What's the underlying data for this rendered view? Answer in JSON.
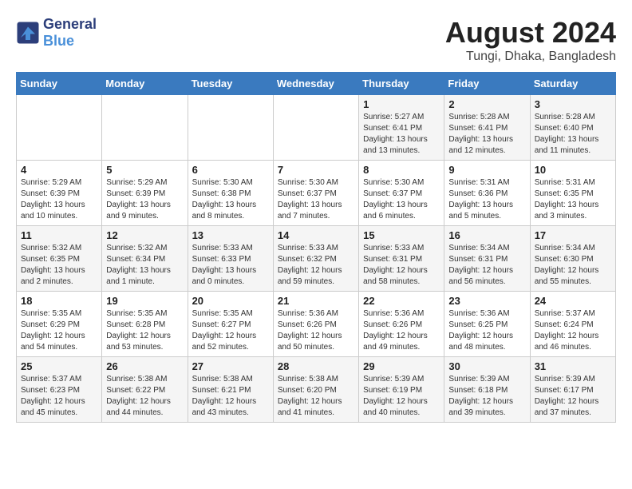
{
  "header": {
    "logo_line1": "General",
    "logo_line2": "Blue",
    "month_year": "August 2024",
    "location": "Tungi, Dhaka, Bangladesh"
  },
  "weekdays": [
    "Sunday",
    "Monday",
    "Tuesday",
    "Wednesday",
    "Thursday",
    "Friday",
    "Saturday"
  ],
  "weeks": [
    [
      {
        "day": "",
        "info": ""
      },
      {
        "day": "",
        "info": ""
      },
      {
        "day": "",
        "info": ""
      },
      {
        "day": "",
        "info": ""
      },
      {
        "day": "1",
        "info": "Sunrise: 5:27 AM\nSunset: 6:41 PM\nDaylight: 13 hours\nand 13 minutes."
      },
      {
        "day": "2",
        "info": "Sunrise: 5:28 AM\nSunset: 6:41 PM\nDaylight: 13 hours\nand 12 minutes."
      },
      {
        "day": "3",
        "info": "Sunrise: 5:28 AM\nSunset: 6:40 PM\nDaylight: 13 hours\nand 11 minutes."
      }
    ],
    [
      {
        "day": "4",
        "info": "Sunrise: 5:29 AM\nSunset: 6:39 PM\nDaylight: 13 hours\nand 10 minutes."
      },
      {
        "day": "5",
        "info": "Sunrise: 5:29 AM\nSunset: 6:39 PM\nDaylight: 13 hours\nand 9 minutes."
      },
      {
        "day": "6",
        "info": "Sunrise: 5:30 AM\nSunset: 6:38 PM\nDaylight: 13 hours\nand 8 minutes."
      },
      {
        "day": "7",
        "info": "Sunrise: 5:30 AM\nSunset: 6:37 PM\nDaylight: 13 hours\nand 7 minutes."
      },
      {
        "day": "8",
        "info": "Sunrise: 5:30 AM\nSunset: 6:37 PM\nDaylight: 13 hours\nand 6 minutes."
      },
      {
        "day": "9",
        "info": "Sunrise: 5:31 AM\nSunset: 6:36 PM\nDaylight: 13 hours\nand 5 minutes."
      },
      {
        "day": "10",
        "info": "Sunrise: 5:31 AM\nSunset: 6:35 PM\nDaylight: 13 hours\nand 3 minutes."
      }
    ],
    [
      {
        "day": "11",
        "info": "Sunrise: 5:32 AM\nSunset: 6:35 PM\nDaylight: 13 hours\nand 2 minutes."
      },
      {
        "day": "12",
        "info": "Sunrise: 5:32 AM\nSunset: 6:34 PM\nDaylight: 13 hours\nand 1 minute."
      },
      {
        "day": "13",
        "info": "Sunrise: 5:33 AM\nSunset: 6:33 PM\nDaylight: 13 hours\nand 0 minutes."
      },
      {
        "day": "14",
        "info": "Sunrise: 5:33 AM\nSunset: 6:32 PM\nDaylight: 12 hours\nand 59 minutes."
      },
      {
        "day": "15",
        "info": "Sunrise: 5:33 AM\nSunset: 6:31 PM\nDaylight: 12 hours\nand 58 minutes."
      },
      {
        "day": "16",
        "info": "Sunrise: 5:34 AM\nSunset: 6:31 PM\nDaylight: 12 hours\nand 56 minutes."
      },
      {
        "day": "17",
        "info": "Sunrise: 5:34 AM\nSunset: 6:30 PM\nDaylight: 12 hours\nand 55 minutes."
      }
    ],
    [
      {
        "day": "18",
        "info": "Sunrise: 5:35 AM\nSunset: 6:29 PM\nDaylight: 12 hours\nand 54 minutes."
      },
      {
        "day": "19",
        "info": "Sunrise: 5:35 AM\nSunset: 6:28 PM\nDaylight: 12 hours\nand 53 minutes."
      },
      {
        "day": "20",
        "info": "Sunrise: 5:35 AM\nSunset: 6:27 PM\nDaylight: 12 hours\nand 52 minutes."
      },
      {
        "day": "21",
        "info": "Sunrise: 5:36 AM\nSunset: 6:26 PM\nDaylight: 12 hours\nand 50 minutes."
      },
      {
        "day": "22",
        "info": "Sunrise: 5:36 AM\nSunset: 6:26 PM\nDaylight: 12 hours\nand 49 minutes."
      },
      {
        "day": "23",
        "info": "Sunrise: 5:36 AM\nSunset: 6:25 PM\nDaylight: 12 hours\nand 48 minutes."
      },
      {
        "day": "24",
        "info": "Sunrise: 5:37 AM\nSunset: 6:24 PM\nDaylight: 12 hours\nand 46 minutes."
      }
    ],
    [
      {
        "day": "25",
        "info": "Sunrise: 5:37 AM\nSunset: 6:23 PM\nDaylight: 12 hours\nand 45 minutes."
      },
      {
        "day": "26",
        "info": "Sunrise: 5:38 AM\nSunset: 6:22 PM\nDaylight: 12 hours\nand 44 minutes."
      },
      {
        "day": "27",
        "info": "Sunrise: 5:38 AM\nSunset: 6:21 PM\nDaylight: 12 hours\nand 43 minutes."
      },
      {
        "day": "28",
        "info": "Sunrise: 5:38 AM\nSunset: 6:20 PM\nDaylight: 12 hours\nand 41 minutes."
      },
      {
        "day": "29",
        "info": "Sunrise: 5:39 AM\nSunset: 6:19 PM\nDaylight: 12 hours\nand 40 minutes."
      },
      {
        "day": "30",
        "info": "Sunrise: 5:39 AM\nSunset: 6:18 PM\nDaylight: 12 hours\nand 39 minutes."
      },
      {
        "day": "31",
        "info": "Sunrise: 5:39 AM\nSunset: 6:17 PM\nDaylight: 12 hours\nand 37 minutes."
      }
    ]
  ]
}
